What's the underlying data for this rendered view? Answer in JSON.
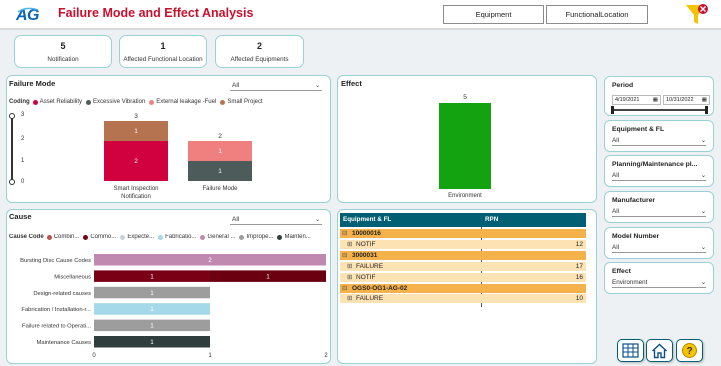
{
  "header": {
    "title": "Failure Mode and Effect Analysis",
    "buttons": [
      "Equipment",
      "FunctionalLocation"
    ]
  },
  "kpis": [
    {
      "value": "5",
      "label": "Notification"
    },
    {
      "value": "1",
      "label": "Affected Functional Location"
    },
    {
      "value": "2",
      "label": "Affected Equipments"
    }
  ],
  "failure_mode": {
    "title": "Failure Mode",
    "dropdown": "All",
    "coding_label": "Coding",
    "legend": [
      {
        "name": "Asset Reliability",
        "color": "#d1003f"
      },
      {
        "name": "Excessive Vibration",
        "color": "#4d5b5a"
      },
      {
        "name": "External leakage -Fuel",
        "color": "#f08080"
      },
      {
        "name": "Small Project",
        "color": "#b5734f"
      }
    ],
    "slider_ticks": [
      "3",
      "2",
      "1",
      "0"
    ]
  },
  "effect": {
    "title": "Effect"
  },
  "cause": {
    "title": "Cause",
    "dropdown": "All",
    "code_label": "Cause Code",
    "legend": [
      {
        "name": "Combin...",
        "color": "#c0504d"
      },
      {
        "name": "Commo...",
        "color": "#7a0016"
      },
      {
        "name": "Expecte...",
        "color": "#c9d3e0"
      },
      {
        "name": "Fabricatio...",
        "color": "#a3d9e8"
      },
      {
        "name": "General ...",
        "color": "#c08ab0"
      },
      {
        "name": "Imprope...",
        "color": "#9d9d9d"
      },
      {
        "name": "Mainten...",
        "color": "#2f3e3d"
      }
    ]
  },
  "table": {
    "headers": [
      "Equipment & FL",
      "RPN"
    ],
    "rows": [
      {
        "label": "10000016",
        "value": "",
        "level": 0,
        "toggle": "⊟"
      },
      {
        "label": "NOTIF",
        "value": "12",
        "level": 1,
        "toggle": "⊞"
      },
      {
        "label": "3000031",
        "value": "",
        "level": 0,
        "toggle": "⊟"
      },
      {
        "label": "FAILURE",
        "value": "17",
        "level": 1,
        "toggle": "⊞"
      },
      {
        "label": "NOTIF",
        "value": "16",
        "level": 1,
        "toggle": "⊞"
      },
      {
        "label": "OGS0-OG1-AG-02",
        "value": "",
        "level": 0,
        "toggle": "⊟"
      },
      {
        "label": "FAILURE",
        "value": "10",
        "level": 1,
        "toggle": "⊞"
      }
    ]
  },
  "filters": {
    "period": {
      "title": "Period",
      "start": "4/19/2021",
      "end": "10/31/2022"
    },
    "items": [
      {
        "title": "Equipment & FL",
        "value": "All"
      },
      {
        "title": "Planning/Maintenance pl...",
        "value": "All"
      },
      {
        "title": "Manufacturer",
        "value": "All"
      },
      {
        "title": "Model Number",
        "value": "All"
      },
      {
        "title": "Effect",
        "value": "Environment"
      }
    ]
  },
  "nav": [
    "table-icon",
    "home-icon",
    "help-icon"
  ],
  "chart_data": [
    {
      "type": "bar",
      "title": "Failure Mode",
      "categories": [
        "Smart Inspection Notification",
        "Failure Mode"
      ],
      "series": [
        {
          "name": "Asset Reliability",
          "values": [
            2,
            0
          ]
        },
        {
          "name": "Excessive Vibration",
          "values": [
            0,
            1
          ]
        },
        {
          "name": "External leakage -Fuel",
          "values": [
            0,
            1
          ]
        },
        {
          "name": "Small Project",
          "values": [
            1,
            0
          ]
        }
      ],
      "totals": [
        3,
        2
      ],
      "stacked": true
    },
    {
      "type": "bar",
      "title": "Effect",
      "categories": [
        "Environment"
      ],
      "values": [
        5
      ],
      "color": "#13a310"
    },
    {
      "type": "bar",
      "orientation": "horizontal",
      "title": "Cause",
      "categories": [
        "Bursting Disc Cause Codes",
        "Miscellaneous",
        "Design-related causes",
        "Fabrication / Installation-r...",
        "Failure related to Operati...",
        "Maintenance Causes"
      ],
      "series": [
        {
          "name": "General ...",
          "values": [
            2,
            0,
            0,
            0,
            0,
            0
          ],
          "color": "#c08ab0"
        },
        {
          "name": "Commo...",
          "values": [
            0,
            1,
            0,
            0,
            0,
            0
          ],
          "color": "#7a0016"
        },
        {
          "name": "Combin...",
          "values": [
            0,
            1,
            0,
            0,
            0,
            0
          ],
          "color": "#6b0010"
        },
        {
          "name": "Imprope...",
          "values": [
            0,
            0,
            1,
            0,
            1,
            0
          ],
          "color": "#9d9d9d"
        },
        {
          "name": "Fabricatio...",
          "values": [
            0,
            0,
            0,
            1,
            0,
            0
          ],
          "color": "#a3d9e8"
        },
        {
          "name": "Mainten...",
          "values": [
            0,
            0,
            0,
            0,
            0,
            1
          ],
          "color": "#2f3e3d"
        }
      ],
      "xticks": [
        "0",
        "1",
        "2"
      ],
      "xlim": [
        0,
        2
      ]
    }
  ]
}
